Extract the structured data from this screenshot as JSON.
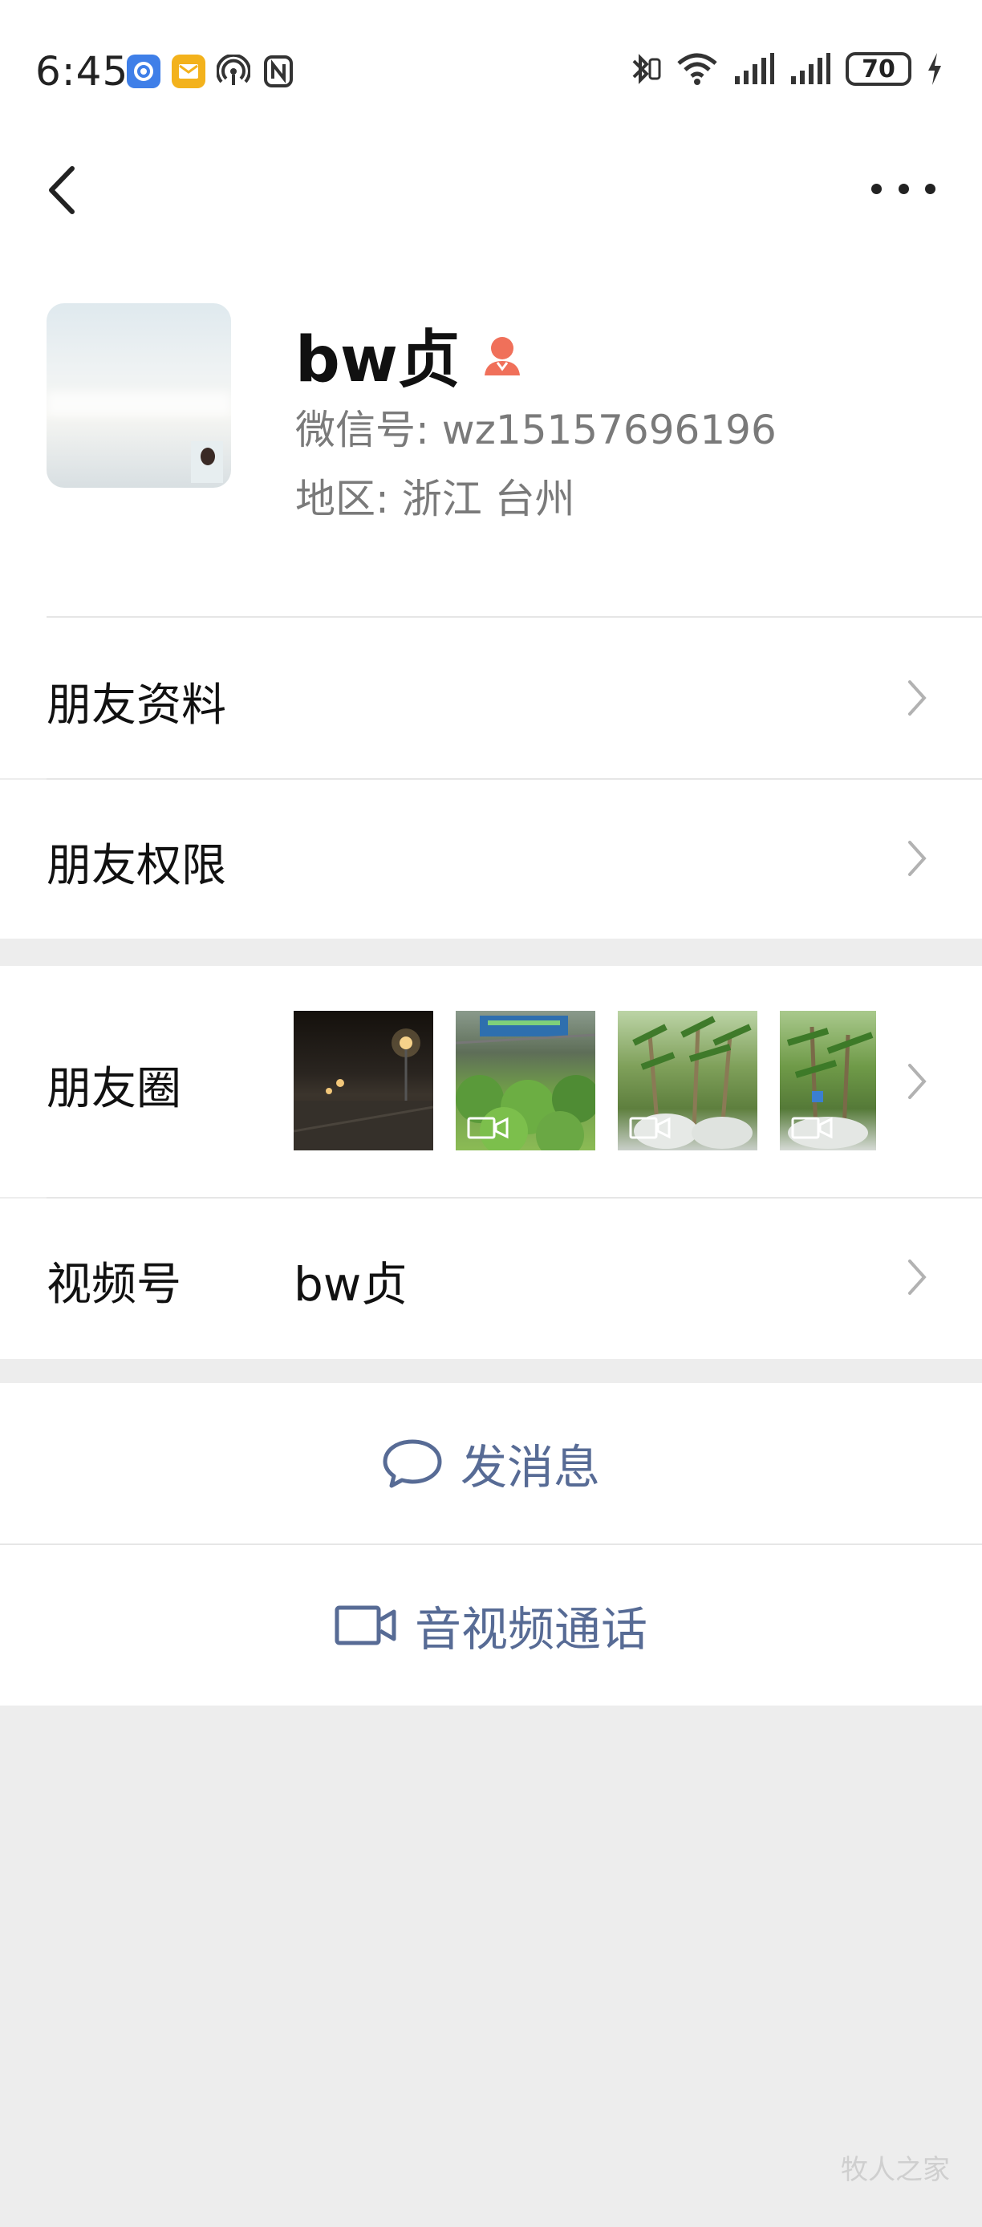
{
  "status_bar": {
    "time": "6:45",
    "battery": "70",
    "left_icons": [
      "app-icon-blue",
      "mail-icon",
      "hotspot-icon",
      "nfc-icon"
    ],
    "right_icons": [
      "bluetooth-icon",
      "wifi-icon",
      "signal-icon",
      "signal-icon",
      "battery-icon",
      "charging-icon"
    ]
  },
  "nav": {
    "back_icon": "chevron-left-icon",
    "more_icon": "more-dots-icon"
  },
  "profile": {
    "name": "bw贞",
    "gender_icon": "female-icon",
    "wechat_id": "微信号:  wz15157696196",
    "region": "地区:  浙江  台州"
  },
  "rows": {
    "friend_info": "朋友资料",
    "friend_permissions": "朋友权限",
    "moments": "朋友圈",
    "channels": "视频号",
    "channels_value": "bw贞"
  },
  "moments_thumbs": [
    {
      "label": "night street photo",
      "video": false
    },
    {
      "label": "nursery plants",
      "video": true
    },
    {
      "label": "potted trees",
      "video": true
    },
    {
      "label": "plant seedlings",
      "video": true
    }
  ],
  "actions": {
    "message": "发消息",
    "call": "音视频通话"
  },
  "watermark": "牧人之家",
  "colors": {
    "link": "#576b95",
    "background": "#ededed",
    "female": "#f0705a"
  }
}
